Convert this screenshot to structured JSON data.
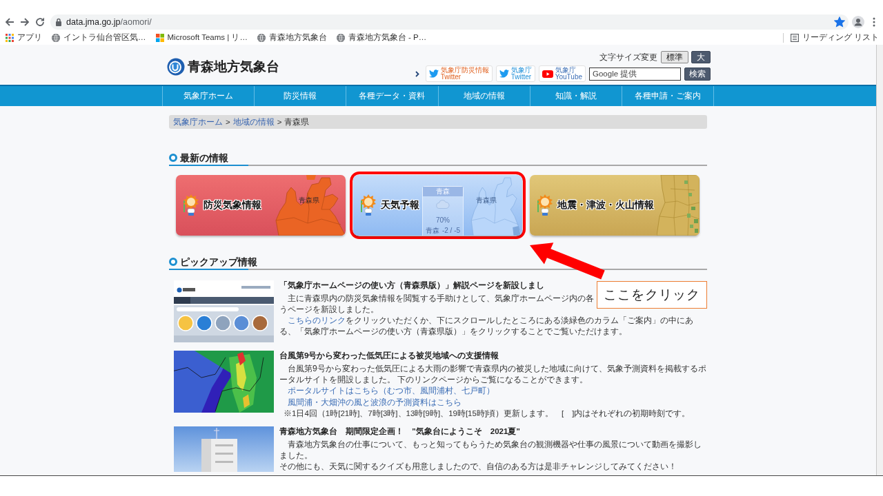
{
  "browser": {
    "address": {
      "host": "data.jma.go.jp",
      "path": "/aomori/"
    },
    "bookmarked": true,
    "bookmarks": [
      {
        "kind": "apps",
        "label": "アプリ"
      },
      {
        "kind": "site",
        "label": "イントラ仙台管区気…"
      },
      {
        "kind": "tiles",
        "label": "Microsoft Teams | リ…"
      },
      {
        "kind": "site",
        "label": "青森地方気象台"
      },
      {
        "kind": "site",
        "label": "青森地方気象台 - P…"
      }
    ],
    "reading_list": "リーディング リスト"
  },
  "header": {
    "site_title": "青森地方気象台",
    "font_size_label": "文字サイズ変更",
    "font_sizes": [
      {
        "label": "標準",
        "selected": true
      },
      {
        "label": "大",
        "selected": false
      }
    ],
    "social_links": [
      {
        "kind": "disaster",
        "name": "気象庁防災情報",
        "service": "Twitter"
      },
      {
        "kind": "twitter",
        "name": "気象庁",
        "service": "Twitter"
      },
      {
        "kind": "youtube",
        "name": "気象庁",
        "service": "YouTube"
      }
    ],
    "search": {
      "placeholder": "Google 提供",
      "button": "検索"
    }
  },
  "nav": [
    "気象庁ホーム",
    "防災情報",
    "各種データ・資料",
    "地域の情報",
    "知識・解説",
    "各種申請・ご案内"
  ],
  "breadcrumb": [
    {
      "kind": "link",
      "text": "気象庁ホーム"
    },
    {
      "kind": "separator",
      "text": ">"
    },
    {
      "kind": "link",
      "text": "地域の情報"
    },
    {
      "kind": "separator",
      "text": ">"
    },
    {
      "kind": "current",
      "text": "青森県"
    }
  ],
  "latest": {
    "heading": "最新の情報",
    "cards": [
      {
        "kind": "warning",
        "title": "防災気象情報",
        "map_label": "青森県",
        "highlighted": false
      },
      {
        "kind": "forecast",
        "title": "天気予報",
        "map_label": "青森県",
        "widget": {
          "title": "青森",
          "chance": "70%",
          "city": "青森",
          "temps": "-2 / -5"
        },
        "highlighted": true
      },
      {
        "kind": "quake",
        "title": "地震・津波・火山情報",
        "highlighted": false
      }
    ]
  },
  "pickup": {
    "heading": "ピックアップ情報",
    "items": [
      {
        "kind": "guide",
        "title": "「気象庁ホームページの使い方（青森県版）」解説ページを新設しまし",
        "blocks": [
          {
            "kind": "split",
            "parts": [
              "主に青森県内の防災気象情報を閲覧する手助けとして、気象庁ホームページ内の各",
              "うページ",
              "を新設しました。"
            ]
          },
          {
            "kind": "linked",
            "link": "こちらのリンク",
            "text": "をクリックいただくか、下にスクロールしたところにある淡緑色のカラム「ご案内」の中にある、「気象庁ホームページの使い方（青森県版）」をクリックすることでご覧いただけます。"
          }
        ]
      },
      {
        "kind": "support",
        "title": "台風第9号から変わった低気圧による被災地域への支援情報",
        "blocks": [
          {
            "kind": "para",
            "text": "台風第9号から変わった低気圧による大雨の影響で青森県内の被災した地域に向けて、気象予測資料を掲載するポータルサイトを開設しました。 下のリンクページからご覧になることができます。"
          },
          {
            "kind": "link",
            "text": "ポータルサイトはこちら（むつ市、風間浦村、七戸町）"
          },
          {
            "kind": "link",
            "text": "風間浦・大畑沖の風と波浪の予測資料はこちら"
          },
          {
            "kind": "note",
            "text": "※1日4回（1時[21時]、7時[3時]、13時[9時]、19時[15時]頃）更新します。　[　]内はそれぞれの初期時刻です。"
          }
        ]
      },
      {
        "kind": "event",
        "title": "青森地方気象台　期間限定企画！　”気象台にようこそ　2021夏”",
        "blocks": [
          {
            "kind": "para",
            "text": "青森地方気象台の仕事について、もっと知ってもらうため気象台の観測機器や仕事の風景について動画を撮影しました。"
          },
          {
            "kind": "line",
            "text": "その他にも、天気に関するクイズも用意しましたので、自信のある方は是非チャレンジしてみてください！"
          }
        ]
      }
    ]
  },
  "annotation": {
    "callout": "ここをクリック"
  }
}
